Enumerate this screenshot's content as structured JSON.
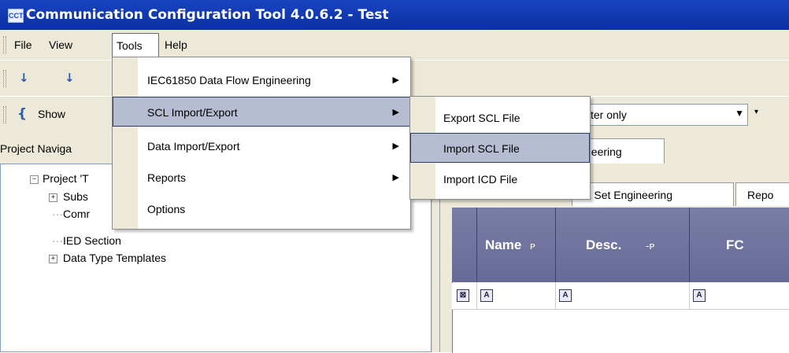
{
  "window": {
    "title": "Communication Configuration Tool 4.0.6.2 - Test",
    "icon_text": "CCT"
  },
  "menubar": [
    "File",
    "View",
    "Tools",
    "Help"
  ],
  "toolbar": {
    "sort_asc_icon": "sort-ascending-icon",
    "sort_desc_icon": "sort-descending-icon",
    "show_label": "Show",
    "filter_value": "cter only"
  },
  "project_navigator": {
    "header": "Project Naviga",
    "tree": [
      {
        "label": "Project 'T",
        "expander": "−"
      },
      {
        "label": "Subs",
        "expander": "+"
      },
      {
        "label": "Comr",
        "expander": ""
      },
      {
        "label": "IED Section",
        "expander": ""
      },
      {
        "label": "Data Type Templates",
        "expander": "+"
      }
    ]
  },
  "tabs": {
    "engineering_tab": "neering"
  },
  "subtabs": {
    "data_set": "ata Set Engineering",
    "reports": "Repo"
  },
  "grid": {
    "columns": [
      "Name",
      "Desc.",
      "FC"
    ],
    "filter_glyph": "A",
    "pin_glyph": "ቅ"
  },
  "tools_menu": {
    "items": [
      {
        "label": "IEC61850 Data Flow Engineering",
        "submenu": true
      },
      {
        "label": "SCL Import/Export",
        "submenu": true,
        "highlighted": true
      },
      {
        "label": "Data Import/Export",
        "submenu": true
      },
      {
        "label": "Reports",
        "submenu": true
      },
      {
        "label": "Options",
        "submenu": false
      }
    ]
  },
  "scl_submenu": {
    "items": [
      {
        "label": "Export SCL File"
      },
      {
        "label": "Import SCL File",
        "highlighted": true
      },
      {
        "label": "Import ICD File"
      }
    ]
  },
  "colors": {
    "title_bar": "#0a2f9e",
    "menu_highlight": "#b6bdd2",
    "grid_header": "#6d719b",
    "chrome": "#ece9d8"
  }
}
